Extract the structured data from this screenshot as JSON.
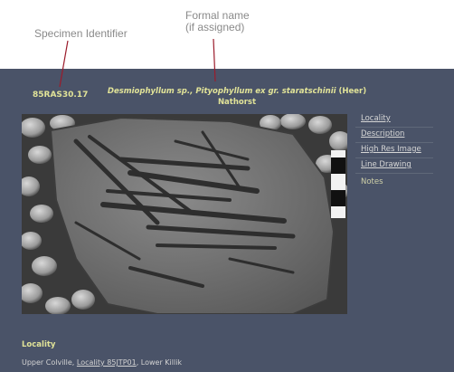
{
  "annotations": {
    "specimen_label": "Specimen Identifier",
    "formal_label_line1": "Formal name",
    "formal_label_line2": "(if assigned)"
  },
  "record": {
    "specimen_id": "85RAS30.17",
    "formal_name_italic": "Desmiophyllum sp., Pityophyllum ex gr. staratschinii",
    "formal_name_author_1": " (Heer)",
    "formal_name_author_2": "Nathorst"
  },
  "nav": {
    "items": [
      {
        "label": "Locality"
      },
      {
        "label": "Description"
      },
      {
        "label": "High Res Image"
      },
      {
        "label": "Line Drawing"
      }
    ],
    "notes_label": "Notes"
  },
  "locality": {
    "heading": "Locality",
    "prefix": "Upper Colville, ",
    "link_label": "Locality 85JTP01",
    "suffix": ", Lower Killik"
  },
  "colors": {
    "panel_bg": "#4a5368",
    "accent_yellow": "#e1e398",
    "annotation_gray": "#8a8a8a",
    "leader_red": "#9b1b2b"
  }
}
